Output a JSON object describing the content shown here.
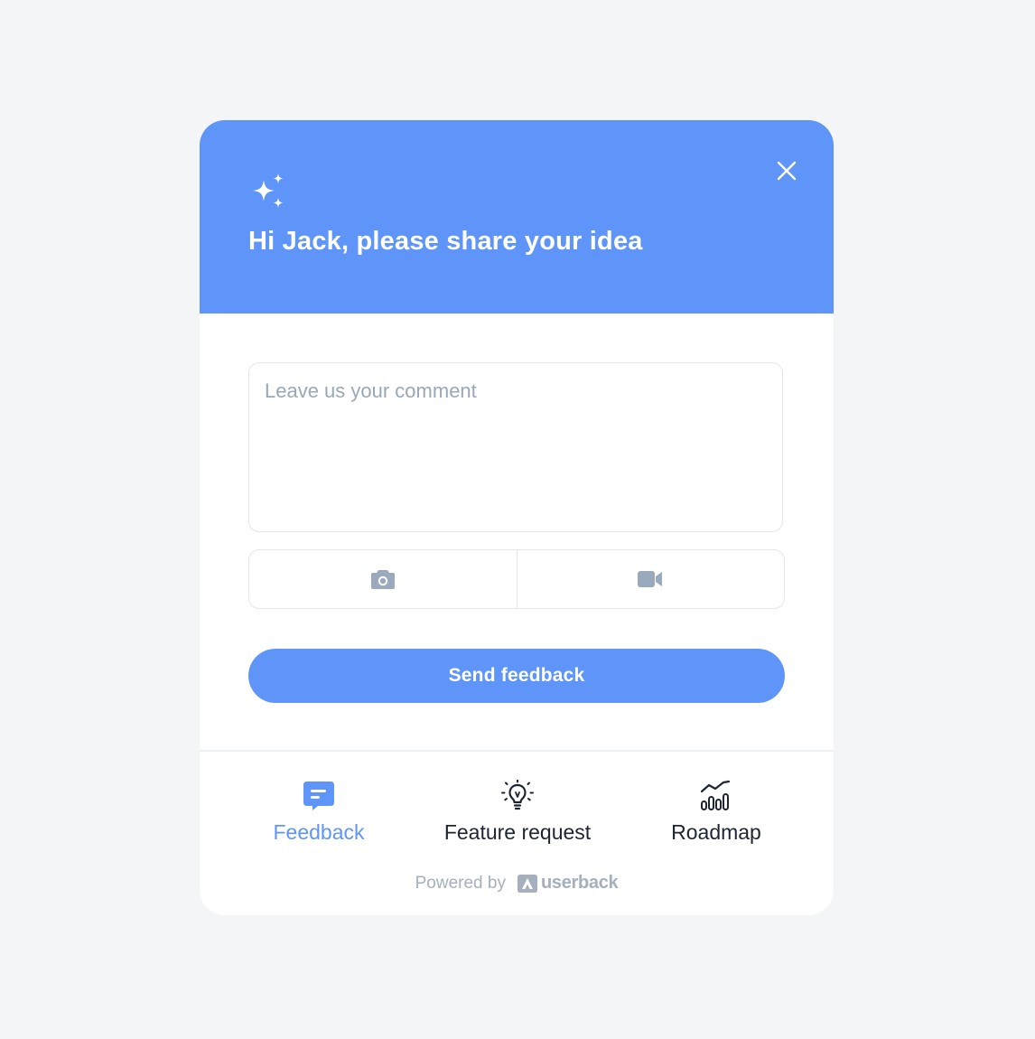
{
  "header": {
    "title": "Hi Jack, please share your idea",
    "background_color": "#5f95f8",
    "icon": "sparkles-icon",
    "close_icon": "close-icon"
  },
  "comment": {
    "placeholder": "Leave us your comment",
    "value": ""
  },
  "capture": {
    "screenshot_icon": "camera-icon",
    "video_icon": "video-icon"
  },
  "send_button": {
    "label": "Send feedback"
  },
  "nav": {
    "items": [
      {
        "label": "Feedback",
        "icon": "feedback-icon",
        "active": true
      },
      {
        "label": "Feature request",
        "icon": "lightbulb-icon",
        "active": false
      },
      {
        "label": "Roadmap",
        "icon": "roadmap-chart-icon",
        "active": false
      }
    ]
  },
  "footer": {
    "powered_by": "Powered by",
    "brand": "userback"
  },
  "colors": {
    "accent": "#5f95f8",
    "page_background": "#f3f5f7",
    "muted_text": "#a5afbd"
  }
}
